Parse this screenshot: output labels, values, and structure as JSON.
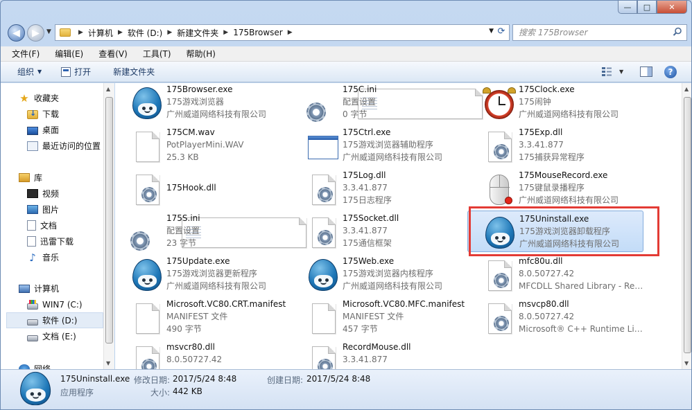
{
  "window": {
    "caption_buttons": [
      "—",
      "□",
      "✕"
    ]
  },
  "address": {
    "crumbs": [
      "计算机",
      "软件 (D:)",
      "新建文件夹",
      "175Browser"
    ],
    "search_placeholder": "搜索 175Browser"
  },
  "menu": [
    "文件(F)",
    "编辑(E)",
    "查看(V)",
    "工具(T)",
    "帮助(H)"
  ],
  "commands": {
    "organize": "组织",
    "open": "打开",
    "new_folder": "新建文件夹"
  },
  "nav": {
    "favorites": {
      "label": "收藏夹",
      "items": [
        "下载",
        "桌面",
        "最近访问的位置"
      ]
    },
    "libraries": {
      "label": "库",
      "items": [
        "视频",
        "图片",
        "文档",
        "迅雷下载",
        "音乐"
      ]
    },
    "computer": {
      "label": "计算机",
      "items": [
        "WIN7 (C:)",
        "软件 (D:)",
        "文档 (E:)"
      ],
      "selected": "软件 (D:)"
    },
    "network": {
      "label": "网络"
    }
  },
  "files": [
    {
      "name": "175Browser.exe",
      "l2": "175游戏浏览器",
      "l3": "广州威道网络科技有限公司",
      "icon": "egg-app-icon"
    },
    {
      "name": "175C.ini",
      "l2": "配置设置",
      "l3": "0 字节",
      "icon": "settings-file-icon"
    },
    {
      "name": "175Clock.exe",
      "l2": "175闹钟",
      "l3": "广州威道网络科技有限公司",
      "icon": "alarm-clock-icon"
    },
    {
      "name": "175CM.wav",
      "l2": "PotPlayerMini.WAV",
      "l3": "25.3 KB",
      "icon": "blank-file-icon"
    },
    {
      "name": "175Ctrl.exe",
      "l2": "175游戏浏览器辅助程序",
      "l3": "广州威道网络科技有限公司",
      "icon": "window-app-icon"
    },
    {
      "name": "175Exp.dll",
      "l2": "3.3.41.877",
      "l3": "175捕获异常程序",
      "icon": "dll-gear-icon"
    },
    {
      "name": "175Hook.dll",
      "l2": "",
      "l3": "",
      "icon": "dll-gear-icon"
    },
    {
      "name": "175Log.dll",
      "l2": "3.3.41.877",
      "l3": "175日志程序",
      "icon": "dll-gear-icon"
    },
    {
      "name": "175MouseRecord.exe",
      "l2": "175键鼠录播程序",
      "l3": "广州威道网络科技有限公司",
      "icon": "mouse-record-icon"
    },
    {
      "name": "175S.ini",
      "l2": "配置设置",
      "l3": "23 字节",
      "icon": "settings-file-icon"
    },
    {
      "name": "175Socket.dll",
      "l2": "3.3.41.877",
      "l3": "175通信框架",
      "icon": "dll-gear-icon"
    },
    {
      "name": "175Uninstall.exe",
      "l2": "175游戏浏览器卸载程序",
      "l3": "广州威道网络科技有限公司",
      "icon": "egg-app-icon"
    },
    {
      "name": "175Update.exe",
      "l2": "175游戏浏览器更新程序",
      "l3": "广州威道网络科技有限公司",
      "icon": "egg-app-icon"
    },
    {
      "name": "175Web.exe",
      "l2": "175游戏浏览器内核程序",
      "l3": "广州威道网络科技有限公司",
      "icon": "egg-app-icon"
    },
    {
      "name": "mfc80u.dll",
      "l2": "8.0.50727.42",
      "l3": "MFCDLL Shared Library - Retai...",
      "icon": "dll-gear-icon"
    },
    {
      "name": "Microsoft.VC80.CRT.manifest",
      "l2": "MANIFEST 文件",
      "l3": "490 字节",
      "icon": "blank-file-icon"
    },
    {
      "name": "Microsoft.VC80.MFC.manifest",
      "l2": "MANIFEST 文件",
      "l3": "457 字节",
      "icon": "blank-file-icon"
    },
    {
      "name": "msvcp80.dll",
      "l2": "8.0.50727.42",
      "l3": "Microsoft® C++ Runtime Libr...",
      "icon": "dll-gear-icon"
    },
    {
      "name": "msvcr80.dll",
      "l2": "8.0.50727.42",
      "l3": "",
      "icon": "dll-gear-icon"
    },
    {
      "name": "RecordMouse.dll",
      "l2": "3.3.41.877",
      "l3": "",
      "icon": "dll-gear-icon"
    }
  ],
  "selected_file": "175Uninstall.exe",
  "details": {
    "name": "175Uninstall.exe",
    "type": "应用程序",
    "modified_label": "修改日期:",
    "modified": "2017/5/24 8:48",
    "created_label": "创建日期:",
    "created": "2017/5/24 8:48",
    "size_label": "大小:",
    "size": "442 KB"
  },
  "colors": {
    "highlight_box": "#e33b35",
    "selection": "#c3dcf8"
  }
}
